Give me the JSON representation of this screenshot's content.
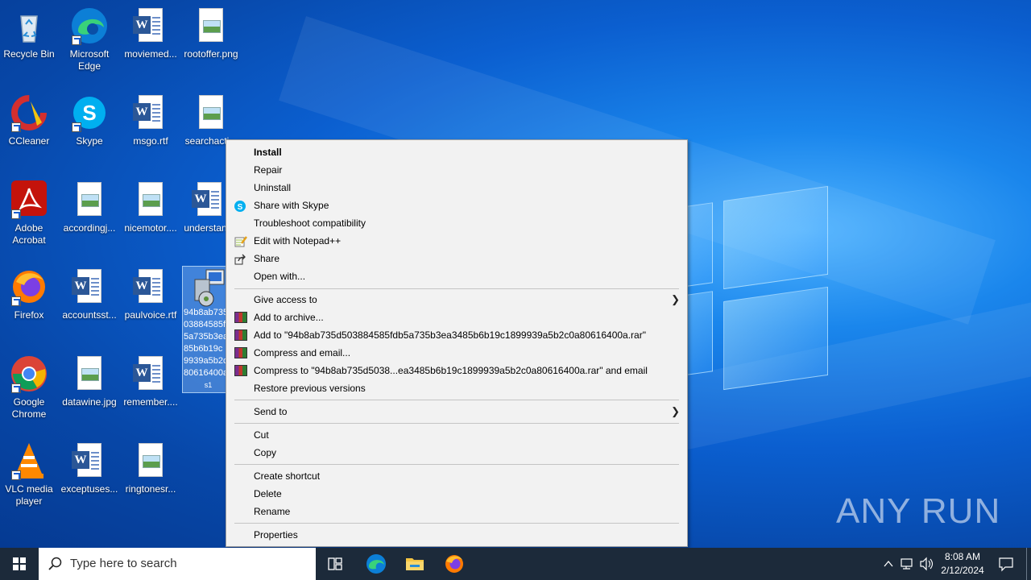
{
  "desktop_icons": [
    {
      "label": "Recycle Bin"
    },
    {
      "label": "Microsoft Edge"
    },
    {
      "label": "moviemed..."
    },
    {
      "label": "rootoffer.png"
    },
    {
      "label": "CCleaner"
    },
    {
      "label": "Skype"
    },
    {
      "label": "msgo.rtf"
    },
    {
      "label": "searchacti..."
    },
    {
      "label": "Adobe Acrobat"
    },
    {
      "label": "accordingj..."
    },
    {
      "label": "nicemotor...."
    },
    {
      "label": "understan..."
    },
    {
      "label": "Firefox"
    },
    {
      "label": "accountsst..."
    },
    {
      "label": "paulvoice.rtf"
    },
    {
      "label": "Google Chrome"
    },
    {
      "label": "datawine.jpg"
    },
    {
      "label": "remember...."
    },
    {
      "label": "VLC media player"
    },
    {
      "label": "exceptuses..."
    },
    {
      "label": "ringtonesr..."
    }
  ],
  "selected_file": {
    "label_lines": [
      "94b8ab735",
      "03884585f",
      "5a735b3ea",
      "85b6b19c",
      "9939a5b2c",
      "80616400a",
      "s1"
    ]
  },
  "context_menu": {
    "items": [
      {
        "label": "Install",
        "bold": true
      },
      {
        "label": "Repair"
      },
      {
        "label": "Uninstall"
      },
      {
        "label": "Share with Skype",
        "icon": "skype-icon"
      },
      {
        "label": "Troubleshoot compatibility"
      },
      {
        "label": "Edit with Notepad++",
        "icon": "notepadpp-icon"
      },
      {
        "label": "Share",
        "icon": "share-icon"
      },
      {
        "label": "Open with..."
      },
      {
        "label": "Give access to",
        "submenu": true
      },
      {
        "label": "Add to archive...",
        "icon": "winrar-icon"
      },
      {
        "label": "Add to \"94b8ab735d503884585fdb5a735b3ea3485b6b19c1899939a5b2c0a80616400a.rar\"",
        "icon": "winrar-icon"
      },
      {
        "label": "Compress and email...",
        "icon": "winrar-icon"
      },
      {
        "label": "Compress to \"94b8ab735d5038...ea3485b6b19c1899939a5b2c0a80616400a.rar\" and email",
        "icon": "winrar-icon"
      },
      {
        "label": "Restore previous versions"
      },
      {
        "label": "Send to",
        "submenu": true
      },
      {
        "label": "Cut"
      },
      {
        "label": "Copy"
      },
      {
        "label": "Create shortcut"
      },
      {
        "label": "Delete"
      },
      {
        "label": "Rename"
      },
      {
        "label": "Properties"
      }
    ]
  },
  "taskbar": {
    "search_placeholder": "Type here to search",
    "time": "8:08 AM",
    "date": "2/12/2024"
  },
  "watermark": "ANY RUN",
  "colors": {
    "accent": "#0b5fd0",
    "taskbar": "#1c2a3a",
    "menu_bg": "#f2f2f2"
  }
}
